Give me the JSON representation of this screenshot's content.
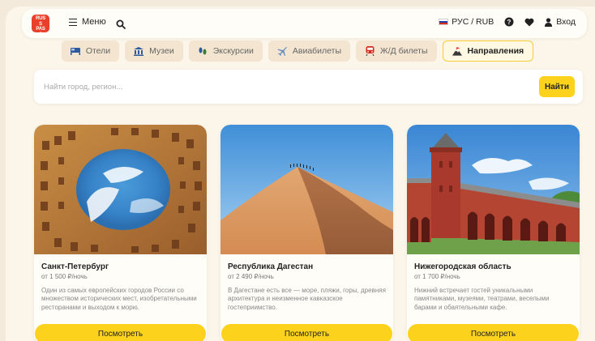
{
  "brand": {
    "logo_text": "RUSS PASS"
  },
  "header": {
    "menu_label": "Меню",
    "locale_label": "РУС / RUB",
    "login_label": "Вход"
  },
  "tabs": [
    {
      "label": "Отели",
      "icon": "bed-icon"
    },
    {
      "label": "Музеи",
      "icon": "museum-icon"
    },
    {
      "label": "Экскурсии",
      "icon": "footprints-icon"
    },
    {
      "label": "Авиабилеты",
      "icon": "plane-icon"
    },
    {
      "label": "Ж/Д билеты",
      "icon": "train-icon"
    },
    {
      "label": "Направления",
      "icon": "mountain-icon",
      "active": true
    }
  ],
  "search": {
    "placeholder": "Найти город, регион...",
    "value": "",
    "button_label": "Найти"
  },
  "cards": [
    {
      "title": "Санкт-Петербург",
      "price": "от 1 500 ₽/ночь",
      "description": "Один из самых европейских городов России со множеством исторических мест, изобретательными ресторанами и выходом к морю.",
      "button_label": "Посмотреть"
    },
    {
      "title": "Республика Дагестан",
      "price": "от 2 490 ₽/ночь",
      "description": "В Дагестане есть все — море, пляжи, горы, древняя архитектура и неизменное кавказское гостеприимство.",
      "button_label": "Посмотреть"
    },
    {
      "title": "Нижегородская область",
      "price": "от 1 700 ₽/ночь",
      "description": "Нижний встречает гостей уникальными памятниками, музеями, театрами, веселыми барами и обаятельными кафе.",
      "button_label": "Посмотреть"
    }
  ],
  "colors": {
    "accent": "#fcd21c",
    "logo": "#e8402a",
    "background": "#f4eadb"
  }
}
